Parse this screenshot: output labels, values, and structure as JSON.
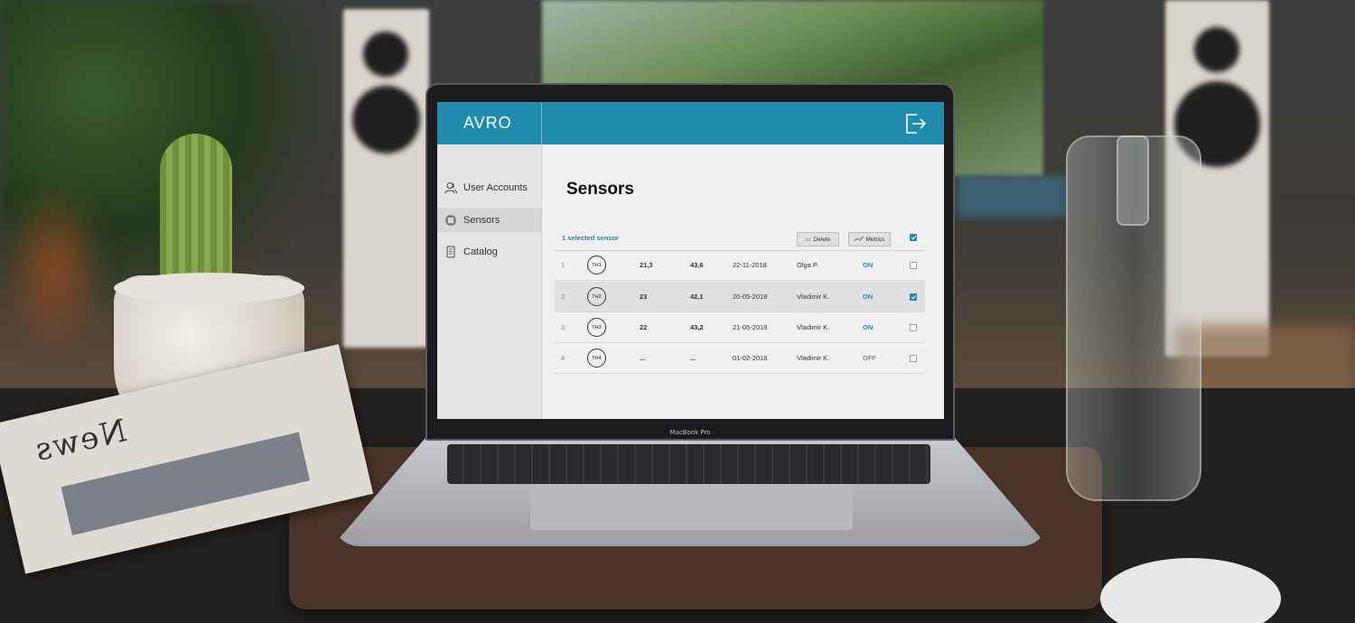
{
  "laptop": {
    "model_label": "MacBook Pro"
  },
  "newspaper": {
    "title": "News"
  },
  "app": {
    "logo": "AVRO",
    "logout_icon": "logout-icon",
    "accent_color": "#1f8cad",
    "sidebar": {
      "items": [
        {
          "label": "User Accounts",
          "icon": "users-icon",
          "active": false
        },
        {
          "label": "Sensors",
          "icon": "chip-icon",
          "active": true
        },
        {
          "label": "Catalog",
          "icon": "catalog-icon",
          "active": false
        }
      ]
    },
    "main": {
      "title": "Sensors",
      "selection_info": "1 selected sensor",
      "delete_label": "Delete",
      "metrics_label": "Metrics",
      "rows": [
        {
          "index": "1",
          "id": "TH1",
          "value1": "21,3",
          "value2": "43,6",
          "date": "22-11-2018",
          "user": "Olga P.",
          "status": "ON",
          "selected": false
        },
        {
          "index": "2",
          "id": "TH2",
          "value1": "23",
          "value2": "42,1",
          "date": "20-05-2018",
          "user": "Vladimir K.",
          "status": "ON",
          "selected": true
        },
        {
          "index": "3",
          "id": "TH3",
          "value1": "22",
          "value2": "43,2",
          "date": "21-05-2018",
          "user": "Vladimir K.",
          "status": "ON",
          "selected": false
        },
        {
          "index": "4",
          "id": "TH4",
          "value1": "...",
          "value2": "...",
          "date": "01-02-2018",
          "user": "Vladimir K.",
          "status": "OFF",
          "selected": false
        }
      ]
    }
  }
}
